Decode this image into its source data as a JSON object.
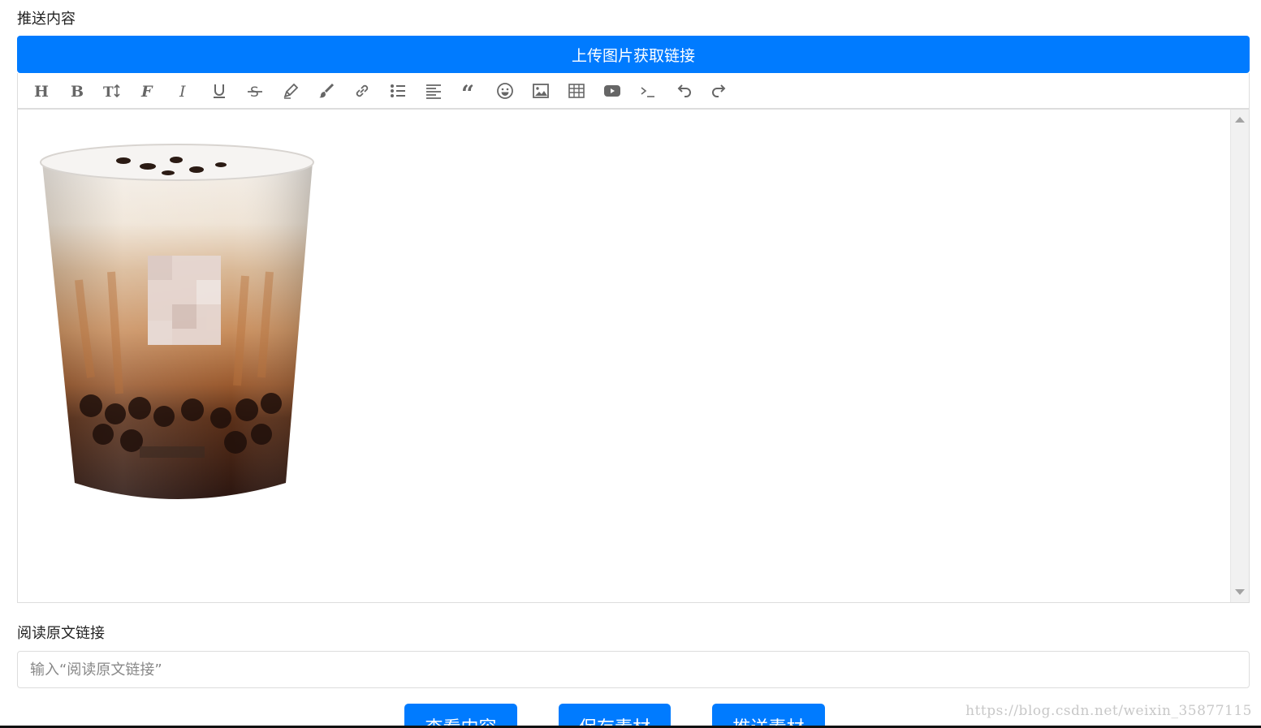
{
  "content_section": {
    "label": "推送内容"
  },
  "upload_button": {
    "label": "上传图片获取链接"
  },
  "toolbar": {
    "tools": [
      {
        "name": "heading-icon",
        "glyph": "H"
      },
      {
        "name": "bold-icon",
        "glyph": "B"
      },
      {
        "name": "font-size-icon",
        "glyph": "T↕"
      },
      {
        "name": "font-family-icon",
        "glyph": "F"
      },
      {
        "name": "italic-icon",
        "glyph": "I"
      },
      {
        "name": "underline-icon",
        "glyph": "U"
      },
      {
        "name": "strikethrough-icon",
        "glyph": "S"
      },
      {
        "name": "text-color-icon",
        "glyph": "pencil"
      },
      {
        "name": "background-color-icon",
        "glyph": "brush"
      },
      {
        "name": "link-icon",
        "glyph": "link"
      },
      {
        "name": "list-icon",
        "glyph": "list"
      },
      {
        "name": "align-icon",
        "glyph": "align"
      },
      {
        "name": "quote-icon",
        "glyph": "quote"
      },
      {
        "name": "emoticon-icon",
        "glyph": "smile"
      },
      {
        "name": "image-icon",
        "glyph": "image"
      },
      {
        "name": "table-icon",
        "glyph": "table"
      },
      {
        "name": "video-icon",
        "glyph": "video"
      },
      {
        "name": "code-icon",
        "glyph": ">_"
      },
      {
        "name": "undo-icon",
        "glyph": "undo"
      },
      {
        "name": "redo-icon",
        "glyph": "redo"
      }
    ]
  },
  "read_original": {
    "label": "阅读原文链接",
    "placeholder": "输入“阅读原文链接”"
  },
  "buttons": {
    "view": "查看内容",
    "save": "保存素材",
    "push": "推送素材"
  },
  "watermark": "https://blog.csdn.net/weixin_35877115",
  "colors": {
    "primary": "#007bff",
    "border": "#dddddd"
  }
}
